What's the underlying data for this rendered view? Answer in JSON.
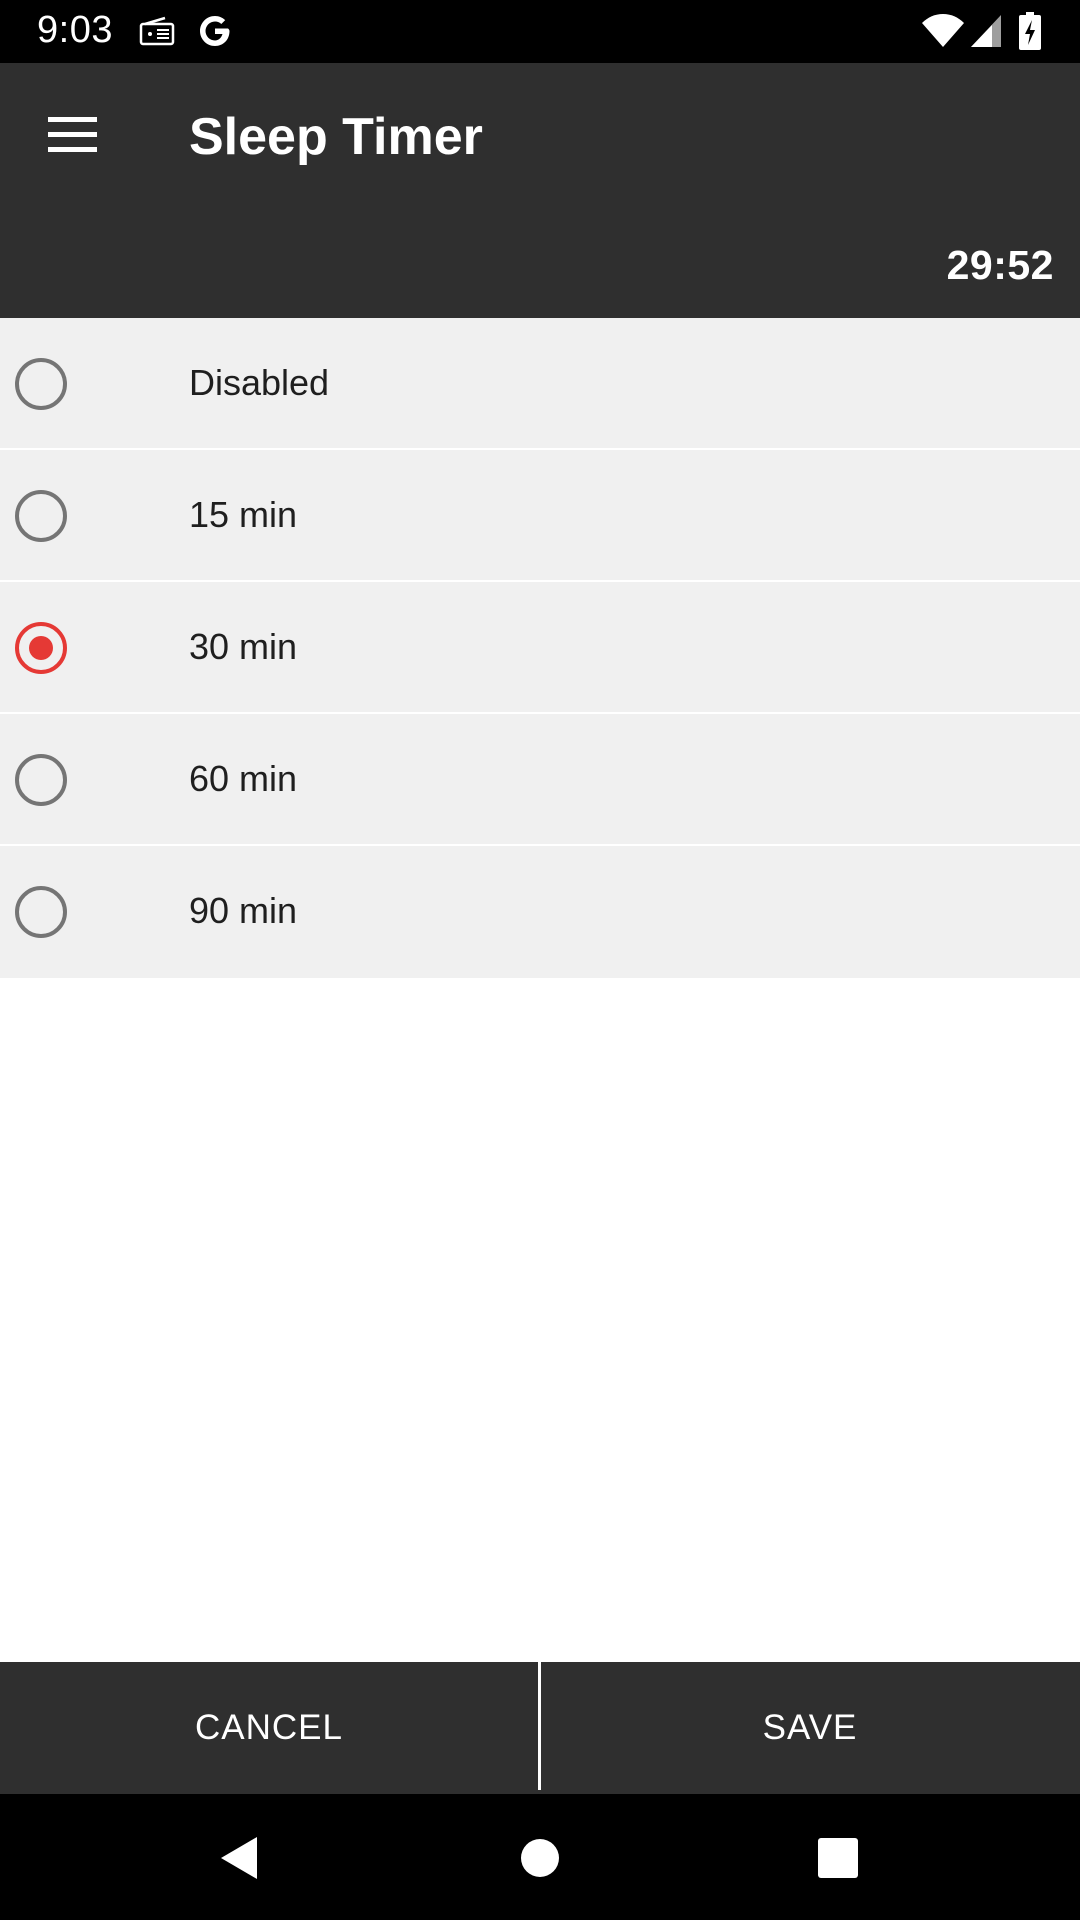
{
  "status_bar": {
    "time": "9:03",
    "icons": [
      "radio-icon",
      "google-icon",
      "wifi-icon",
      "cell-signal-icon",
      "battery-charging-icon"
    ]
  },
  "toolbar": {
    "menu_icon": "hamburger-menu-icon",
    "title": "Sleep Timer"
  },
  "timer": {
    "remaining": "29:52"
  },
  "options": [
    {
      "label": "Disabled",
      "selected": false
    },
    {
      "label": "15 min",
      "selected": false
    },
    {
      "label": "30 min",
      "selected": true
    },
    {
      "label": "60 min",
      "selected": false
    },
    {
      "label": "90 min",
      "selected": false
    }
  ],
  "actions": {
    "cancel_label": "CANCEL",
    "save_label": "SAVE"
  },
  "nav_bar": {
    "icons": [
      "back-icon",
      "home-icon",
      "recents-icon"
    ]
  },
  "colors": {
    "bar_background": "#2f2f2f",
    "accent": "#e53935",
    "row_background": "#f0f0f0"
  }
}
